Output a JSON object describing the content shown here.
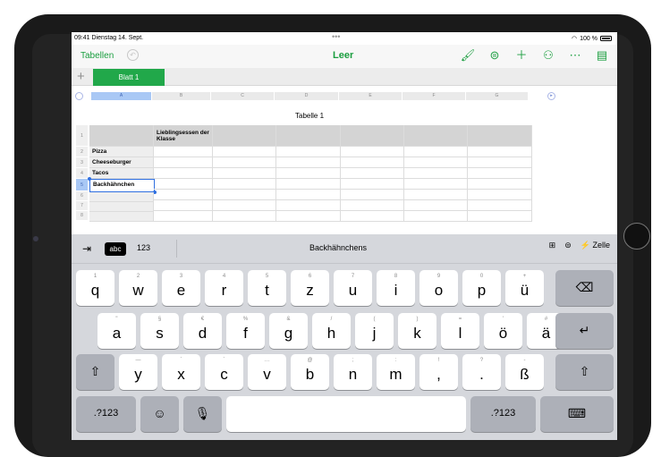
{
  "status_bar": {
    "time": "09:41",
    "date": "Dienstag 14. Sept.",
    "dots": "•••",
    "battery": "100 %",
    "wifi_icon": "wifi-icon"
  },
  "toolbar": {
    "back_label": "Tabellen",
    "undo_icon": "undo-icon",
    "title": "Leer",
    "icons": [
      "paintbrush-icon",
      "format-icon",
      "plus-icon",
      "collaborate-icon",
      "more-icon",
      "document-icon"
    ],
    "accent_color": "#1a9e3f"
  },
  "sheet_tabs": {
    "add_label": "+",
    "active_tab": "Blatt 1"
  },
  "columns": [
    "A",
    "B",
    "C",
    "D",
    "E",
    "F",
    "G"
  ],
  "table": {
    "title": "Tabelle 1",
    "header_cell": "Lieblingsessen der Klasse",
    "row_numbers": [
      "1",
      "2",
      "3",
      "4",
      "5",
      "6",
      "7",
      "8"
    ],
    "rows": [
      "Pizza",
      "Cheeseburger",
      "Tacos",
      "Backhähnchen"
    ],
    "active_cell_value": "Backhähnchen"
  },
  "keyboard": {
    "toolbar": {
      "tab_icon": "tab-arrow-icon",
      "abc_label": "abc",
      "num_label": "123",
      "suggestion": "Backhähnchens",
      "right_icons": [
        "cell-format-icon",
        "equals-icon"
      ],
      "cell_label": "Zelle"
    },
    "row1": [
      {
        "alt": "1",
        "main": "q"
      },
      {
        "alt": "2",
        "main": "w"
      },
      {
        "alt": "3",
        "main": "e"
      },
      {
        "alt": "4",
        "main": "r"
      },
      {
        "alt": "5",
        "main": "t"
      },
      {
        "alt": "6",
        "main": "z"
      },
      {
        "alt": "7",
        "main": "u"
      },
      {
        "alt": "8",
        "main": "i"
      },
      {
        "alt": "9",
        "main": "o"
      },
      {
        "alt": "0",
        "main": "p"
      },
      {
        "alt": "+",
        "main": "ü"
      }
    ],
    "row2": [
      {
        "alt": "\"",
        "main": "a"
      },
      {
        "alt": "§",
        "main": "s"
      },
      {
        "alt": "€",
        "main": "d"
      },
      {
        "alt": "%",
        "main": "f"
      },
      {
        "alt": "&",
        "main": "g"
      },
      {
        "alt": "/",
        "main": "h"
      },
      {
        "alt": "(",
        "main": "j"
      },
      {
        "alt": ")",
        "main": "k"
      },
      {
        "alt": "=",
        "main": "l"
      },
      {
        "alt": "'",
        "main": "ö"
      },
      {
        "alt": "#",
        "main": "ä"
      }
    ],
    "row3": [
      {
        "alt": "—",
        "main": "y"
      },
      {
        "alt": "`",
        "main": "x"
      },
      {
        "alt": "´",
        "main": "c"
      },
      {
        "alt": "…",
        "main": "v"
      },
      {
        "alt": "@",
        "main": "b"
      },
      {
        "alt": ";",
        "main": "n"
      },
      {
        "alt": ":",
        "main": "m"
      },
      {
        "alt": "!",
        "main": ","
      },
      {
        "alt": "?",
        "main": "."
      },
      {
        "alt": "-",
        "main": "ß"
      }
    ],
    "backspace_icon": "⌫",
    "return_icon": "↵",
    "shift_icon": "⇧",
    "numbers_label": ".?123",
    "emoji_icon": "☺",
    "mic_icon": "🎙",
    "hide_keyboard_icon": "⌨"
  }
}
